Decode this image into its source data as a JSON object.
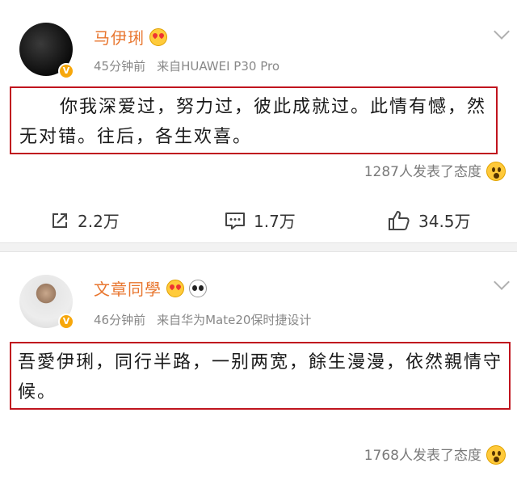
{
  "posts": [
    {
      "author": "马伊琍",
      "time": "45分钟前",
      "source": "来自HUAWEI P30 Pro",
      "content": "你我深爱过，努力过，彼此成就过。此情有憾，然无对错。往后，各生欢喜。",
      "reactions": "1287人发表了态度",
      "actions": {
        "share": "2.2万",
        "comment": "1.7万",
        "like": "34.5万"
      },
      "verified_badge": "V"
    },
    {
      "author": "文章同學",
      "time": "46分钟前",
      "source": "来自华为Mate20保时捷设计",
      "content": "吾愛伊琍，同行半路，一别两宽，餘生漫漫，依然親情守候。",
      "reactions": "1768人发表了态度",
      "verified_badge": "V"
    }
  ],
  "colors": {
    "author_name": "#e8762f",
    "highlight_border": "#c0141e",
    "meta_text": "#888888",
    "verified_badge": "#f7a70b"
  },
  "icons": {
    "share": "share-icon",
    "comment": "comment-icon",
    "like": "thumbs-up-icon",
    "reaction": "wow-emoji-icon",
    "menu": "chevron-down-icon"
  }
}
